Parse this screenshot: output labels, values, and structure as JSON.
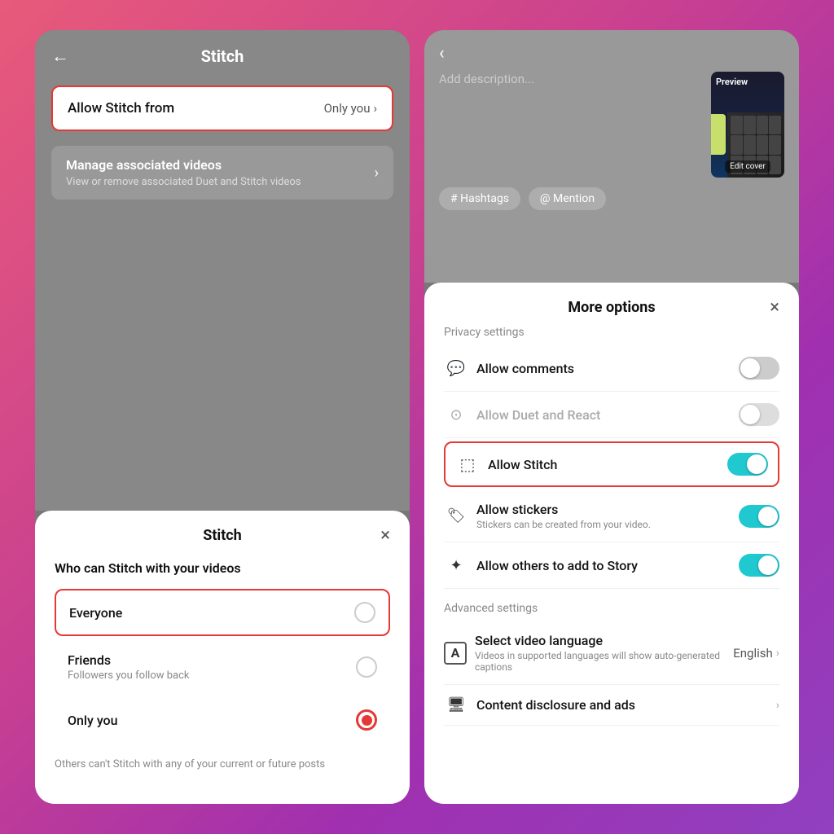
{
  "left": {
    "header": {
      "back_label": "←",
      "title": "Stitch"
    },
    "allow_stitch_from": {
      "label": "Allow Stitch from",
      "value": "Only you",
      "chevron": "›"
    },
    "manage_row": {
      "title": "Manage associated videos",
      "subtitle": "View or remove associated Duet and Stitch videos",
      "chevron": "›"
    },
    "bottom_sheet": {
      "title": "Stitch",
      "close": "×",
      "who_label": "Who can Stitch with your videos",
      "options": [
        {
          "label": "Everyone",
          "sub": "",
          "state": "unchecked",
          "highlighted": true
        },
        {
          "label": "Friends",
          "sub": "Followers you follow back",
          "state": "unchecked",
          "highlighted": false
        },
        {
          "label": "Only you",
          "sub": "",
          "state": "selected",
          "highlighted": false
        }
      ],
      "footer_text": "Others can't Stitch with any of your current or future posts"
    }
  },
  "right": {
    "back_label": "‹",
    "description_placeholder": "Add description...",
    "preview_label": "Preview",
    "edit_cover_label": "Edit cover",
    "hashtag_btn": "# Hashtags",
    "mention_btn": "@ Mention",
    "bottom_sheet": {
      "title": "More options",
      "close": "×",
      "privacy_section_label": "Privacy settings",
      "settings": [
        {
          "icon": "💬",
          "name": "Allow comments",
          "sub": "",
          "toggle": "off",
          "dimmed": false,
          "highlighted": false
        },
        {
          "icon": "⊙",
          "name": "Allow Duet and React",
          "sub": "",
          "toggle": "off",
          "dimmed": true,
          "highlighted": false
        },
        {
          "icon": "⬚",
          "name": "Allow Stitch",
          "sub": "",
          "toggle": "on",
          "dimmed": false,
          "highlighted": true
        },
        {
          "icon": "🏷",
          "name": "Allow stickers",
          "sub": "Stickers can be created from your video.",
          "toggle": "on",
          "dimmed": false,
          "highlighted": false
        },
        {
          "icon": "✦",
          "name": "Allow others to add to Story",
          "sub": "",
          "toggle": "on",
          "dimmed": false,
          "highlighted": false
        }
      ],
      "advanced_section_label": "Advanced settings",
      "language_setting": {
        "icon": "A",
        "name": "Select video language",
        "sub": "Videos in supported languages will show auto-generated captions",
        "value": "English",
        "chevron": "›"
      },
      "disclosure_setting": {
        "icon": "🖥",
        "name": "Content disclosure and ads",
        "chevron": "›"
      }
    }
  }
}
